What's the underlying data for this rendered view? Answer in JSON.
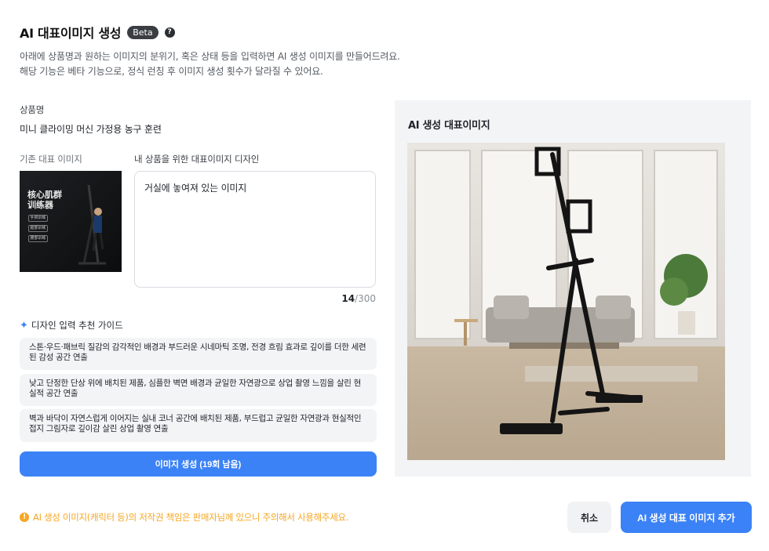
{
  "header": {
    "title": "AI 대표이미지 생성",
    "badge": "Beta",
    "help_icon": "question-circle-icon",
    "desc_line1": "아래에 상품명과 원하는 이미지의 분위기, 혹은 상태 등을 입력하면 AI 생성 이미지를 만들어드려요.",
    "desc_line2": "해당 기능은 베타 기능으로, 정식 런칭 후 이미지 생성 횟수가 달라질 수 있어요."
  },
  "product": {
    "label": "상품명",
    "name": "미니 클라이밍 머신 가정용 농구 훈련"
  },
  "existing_image": {
    "label": "기존 대표 이미지",
    "text": "核心肌群\n训练器",
    "chips": [
      "手臂训练",
      "腿部训练",
      "腰部训练"
    ]
  },
  "design": {
    "label": "내 상품을 위한 대표이미지 디자인",
    "value": "거실에 놓여져 있는 이미지",
    "count": "14",
    "max": "/300"
  },
  "guide": {
    "title": "디자인 입력 추천 가이드",
    "icon": "sparkle-icon",
    "items": [
      "스톤·우드·패브릭 질감의 감각적인 배경과 부드러운 시네마틱 조명, 전경 흐림 효과로 깊이를 더한 세련된 감성 공간 연출",
      "낮고 단정한 단상 위에 배치된 제품, 심플한 벽면 배경과 균일한 자연광으로 상업 촬영 느낌을 살린 현실적 공간 연출",
      "벽과 바닥이 자연스럽게 이어지는 실내 코너 공간에 배치된 제품, 부드럽고 균일한 자연광과 현실적인 접지 그림자로 깊이감 살린 상업 촬영 연출"
    ]
  },
  "generate_button": "이미지 생성 (19회 남음)",
  "result": {
    "title": "AI 생성 대표이미지"
  },
  "notice": {
    "icon": "warning-circle-icon",
    "text": "AI 생성 이미지(캐릭터 등)의 저작권 책임은 판매자님께 있으니 주의해서 사용해주세요."
  },
  "actions": {
    "cancel": "취소",
    "add": "AI 생성 대표 이미지 추가"
  },
  "colors": {
    "primary": "#3b82f6",
    "warning": "#f5a623"
  }
}
